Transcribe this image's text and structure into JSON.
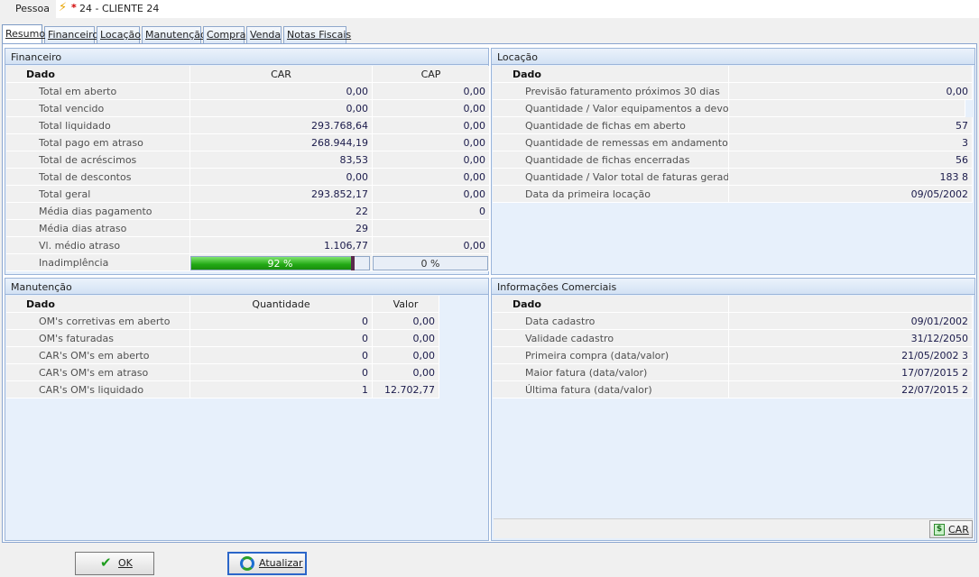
{
  "pessoa": {
    "label": "Pessoa",
    "value": "24 - CLIENTE 24"
  },
  "tabs": [
    "Resumo",
    "Financeiro",
    "Locação",
    "Manutenção",
    "Compra",
    "Venda",
    "Notas Fiscais"
  ],
  "financeiro": {
    "title": "Financeiro",
    "headers": [
      "Dado",
      "CAR",
      "CAP"
    ],
    "rows": [
      [
        "Total em aberto",
        "0,00",
        "0,00"
      ],
      [
        "Total vencido",
        "0,00",
        "0,00"
      ],
      [
        "Total liquidado",
        "293.768,64",
        "0,00"
      ],
      [
        "Total pago em atraso",
        "268.944,19",
        "0,00"
      ],
      [
        "Total de acréscimos",
        "83,53",
        "0,00"
      ],
      [
        "Total de descontos",
        "0,00",
        "0,00"
      ],
      [
        "Total geral",
        "293.852,17",
        "0,00"
      ],
      [
        "Média dias pagamento",
        "22",
        "0"
      ],
      [
        "Média dias atraso",
        "29",
        ""
      ],
      [
        "Vl. médio atraso",
        "1.106,77",
        "0,00"
      ]
    ],
    "inadimplencia": {
      "label": "Inadimplência",
      "car_text": "92 %",
      "car_percent": 92,
      "cap_text": "0 %",
      "cap_percent": 0
    }
  },
  "locacao": {
    "title": "Locação",
    "headers": [
      "Dado",
      ""
    ],
    "rows": [
      [
        "Previsão faturamento próximos 30 dias",
        "0,00"
      ],
      [
        "Quantidade / Valor equipamentos a devolver",
        ""
      ],
      [
        "Quantidade de fichas em aberto",
        "57"
      ],
      [
        "Quantidade de remessas em andamento",
        "3"
      ],
      [
        "Quantidade de fichas encerradas",
        "56"
      ],
      [
        "Quantidade / Valor total de faturas geradas",
        "183 8"
      ],
      [
        "Data da primeira locação",
        "09/05/2002"
      ]
    ]
  },
  "manutencao": {
    "title": "Manutenção",
    "headers": [
      "Dado",
      "Quantidade",
      "Valor"
    ],
    "rows": [
      [
        "OM's corretivas em aberto",
        "0",
        "0,00"
      ],
      [
        "OM's faturadas",
        "0",
        "0,00"
      ],
      [
        "CAR's OM's em aberto",
        "0",
        "0,00"
      ],
      [
        "CAR's OM's em atraso",
        "0",
        "0,00"
      ],
      [
        "CAR's OM's liquidado",
        "1",
        "12.702,77"
      ]
    ]
  },
  "comerciais": {
    "title": "Informações Comerciais",
    "headers": [
      "Dado",
      ""
    ],
    "rows": [
      [
        "Data cadastro",
        "09/01/2002"
      ],
      [
        "Validade cadastro",
        "31/12/2050"
      ],
      [
        "Primeira compra (data/valor)",
        "21/05/2002 3"
      ],
      [
        "Maior fatura (data/valor)",
        "17/07/2015 2"
      ],
      [
        "Última fatura (data/valor)",
        "22/07/2015 2"
      ]
    ],
    "car_button": "CAR"
  },
  "buttons": {
    "ok": "OK",
    "atualizar": "Atualizar"
  }
}
